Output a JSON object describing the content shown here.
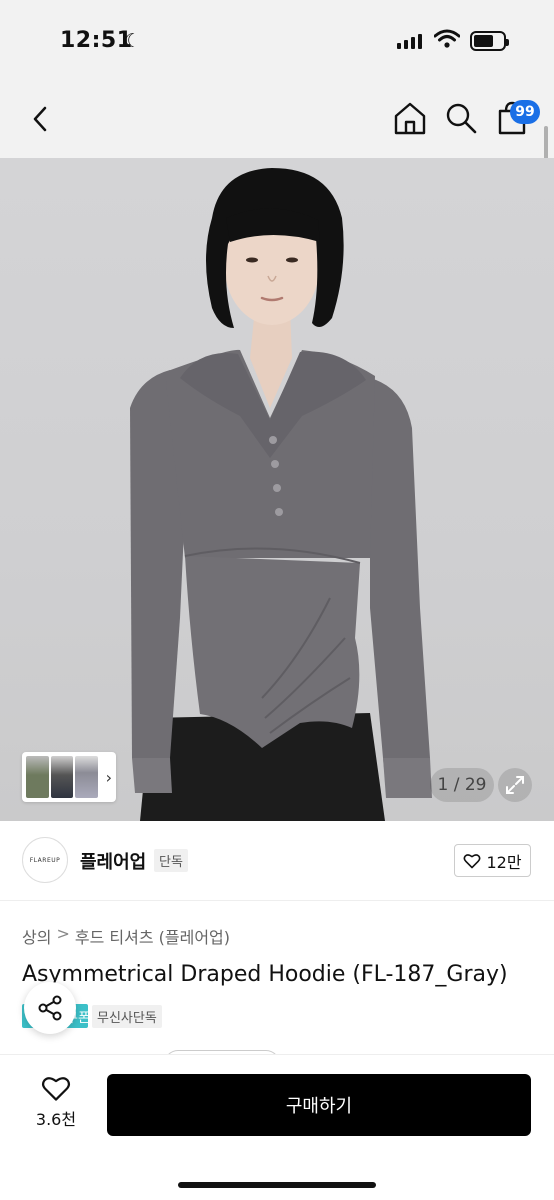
{
  "status_bar": {
    "time": "12:51"
  },
  "nav": {
    "cart_count": "99"
  },
  "gallery": {
    "counter": "1 / 29"
  },
  "brand": {
    "logo_text": "FLAREUP",
    "name": "플레어업",
    "tag": "단독",
    "likes": "12만"
  },
  "breadcrumb": {
    "category": "상의",
    "subcategory": "후드 티셔츠 (플레어업)",
    "separator": ">"
  },
  "product": {
    "title": "Asymmetrical Draped Hoodie (FL-187_Gray)",
    "promo_badge": "쿠폰",
    "exclusive_tag": "무신사단독"
  },
  "bottom_bar": {
    "wish_count": "3.6천",
    "buy_label": "구매하기"
  },
  "colors": {
    "accent": "#1a6fe6",
    "buy_button": "#000000",
    "promo": "#3cc0c8",
    "garment": "#6f6d72"
  }
}
